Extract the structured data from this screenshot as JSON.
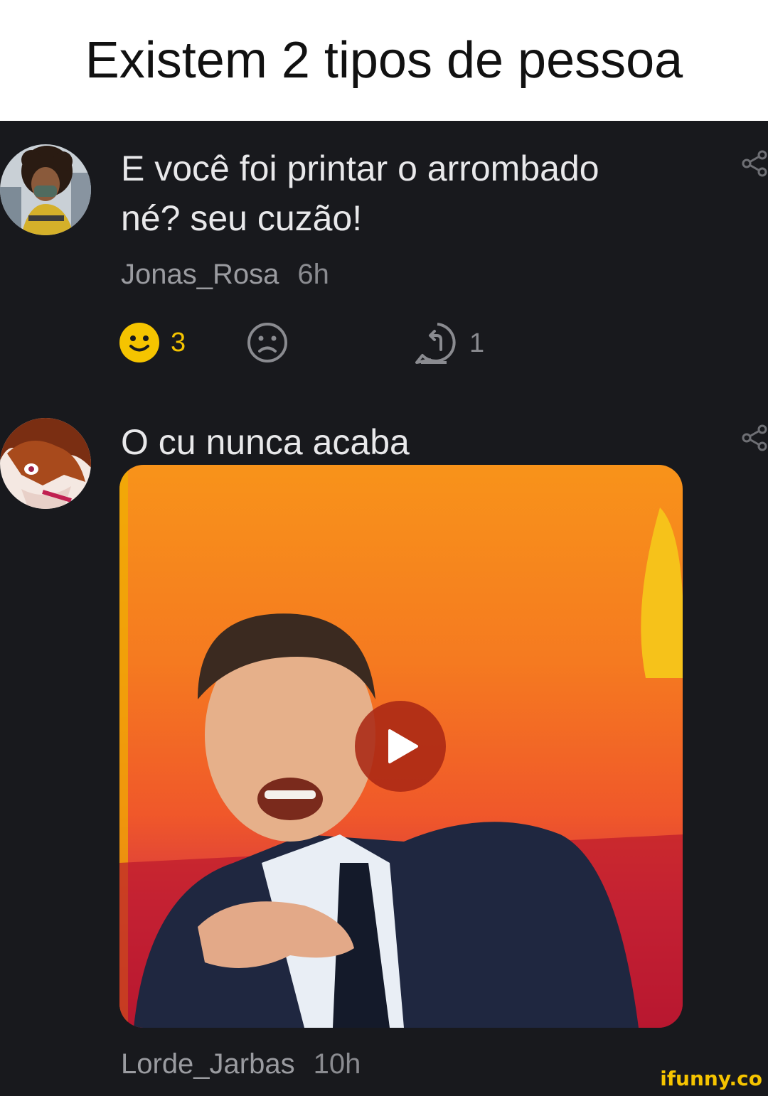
{
  "header": {
    "title": "Existem 2 tipos de pessoa"
  },
  "comments": [
    {
      "text_line1": "E você foi printar o arrombado",
      "text_line2": "né? seu cuzão!",
      "username": "Jonas_Rosa",
      "time": "6h",
      "smile_count": "3",
      "replies_count": "1",
      "smile_active_color": "#f5c400",
      "avatar_icon": "anime-character-gasmask-avatar"
    },
    {
      "text": "O cu nunca acaba",
      "username": "Lorde_Jarbas",
      "time": "10h",
      "media": "video-thumbnail",
      "avatar_icon": "anime-character-brown-hair-avatar"
    }
  ],
  "watermark": "ifunny.co"
}
